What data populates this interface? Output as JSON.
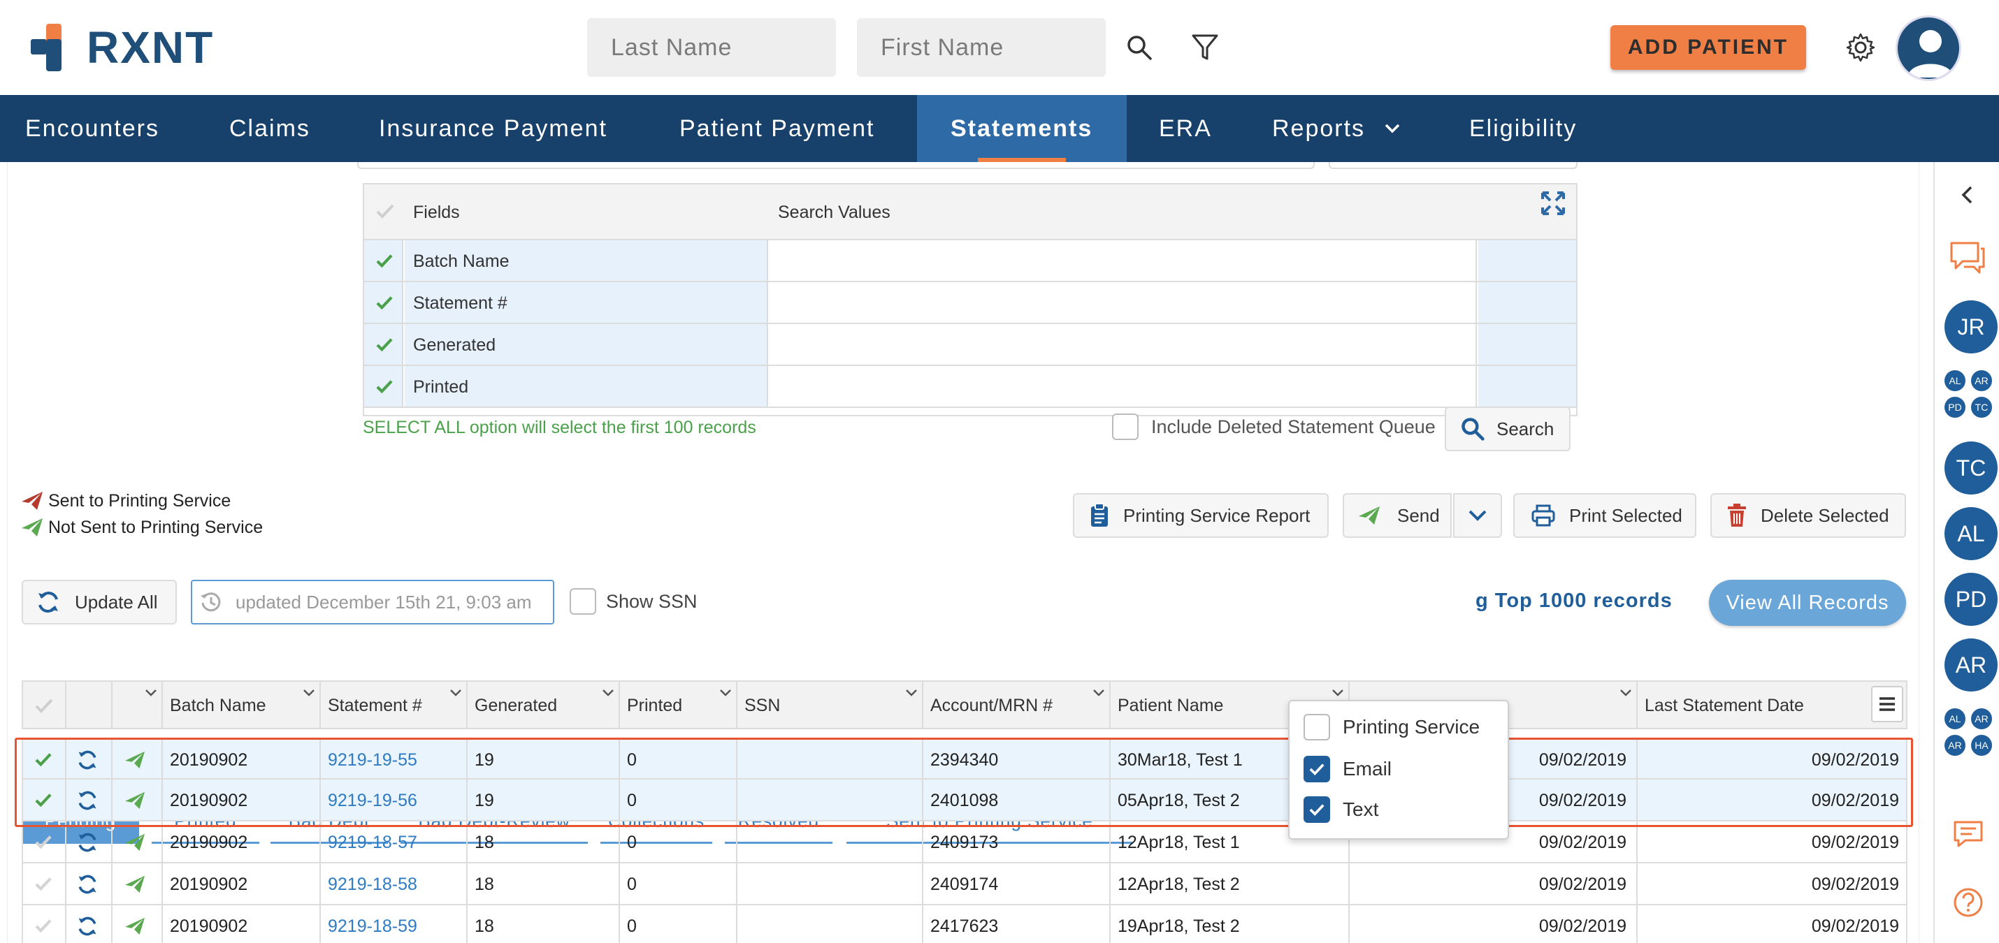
{
  "header": {
    "logo_text": "RXNT",
    "last_name_placeholder": "Last Name",
    "first_name_placeholder": "First Name",
    "add_patient_label": "ADD PATIENT"
  },
  "nav": {
    "items": [
      "Encounters",
      "Claims",
      "Insurance Payment",
      "Patient Payment",
      "Statements",
      "ERA",
      "Reports",
      "Eligibility"
    ],
    "active": "Statements"
  },
  "filters": {
    "col_fields": "Fields",
    "col_values": "Search Values",
    "rows": [
      "Batch Name",
      "Statement #",
      "Generated",
      "Printed"
    ]
  },
  "select_all_note": "SELECT ALL option will select the first 100 records",
  "include_deleted_label": "Include Deleted Statement Queue",
  "search_label": "Search",
  "legend": {
    "sent": "Sent to Printing Service",
    "not_sent": "Not Sent to Printing Service"
  },
  "actions": {
    "printing_report": "Printing Service Report",
    "send": "Send",
    "print_selected": "Print Selected",
    "delete_selected": "Delete Selected"
  },
  "send_menu": {
    "options": [
      {
        "label": "Printing Service",
        "checked": false
      },
      {
        "label": "Email",
        "checked": true
      },
      {
        "label": "Text",
        "checked": true
      }
    ]
  },
  "update_all_label": "Update All",
  "updated_placeholder": "updated December 15th 21, 9:03 am",
  "show_ssn_label": "Show SSN",
  "records_note": "g Top 1000 records",
  "view_all_label": "View All Records",
  "tabs": [
    "Pending",
    "Printed",
    "Bad Debt",
    "Bad Debt-Review",
    "Collections",
    "Resolved",
    "Sent to Printing Service"
  ],
  "table": {
    "headers": [
      "Batch Name",
      "Statement #",
      "Generated",
      "Printed",
      "SSN",
      "Account/MRN #",
      "Patient Name",
      "",
      "Last Statement Date"
    ],
    "rows": [
      {
        "checked": true,
        "selected": true,
        "batch": "20190902",
        "statement": "9219-19-55",
        "generated": "19",
        "printed": "0",
        "ssn": "",
        "account": "2394340",
        "patient": "30Mar18, Test 1",
        "date1": "09/02/2019",
        "last_date": "09/02/2019"
      },
      {
        "checked": true,
        "selected": true,
        "batch": "20190902",
        "statement": "9219-19-56",
        "generated": "19",
        "printed": "0",
        "ssn": "",
        "account": "2401098",
        "patient": "05Apr18, Test 2",
        "date1": "09/02/2019",
        "last_date": "09/02/2019"
      },
      {
        "checked": false,
        "selected": false,
        "batch": "20190902",
        "statement": "9219-18-57",
        "generated": "18",
        "printed": "0",
        "ssn": "",
        "account": "2409173",
        "patient": "12Apr18, Test 1",
        "date1": "09/02/2019",
        "last_date": "09/02/2019"
      },
      {
        "checked": false,
        "selected": false,
        "batch": "20190902",
        "statement": "9219-18-58",
        "generated": "18",
        "printed": "0",
        "ssn": "",
        "account": "2409174",
        "patient": "12Apr18, Test 2",
        "date1": "09/02/2019",
        "last_date": "09/02/2019"
      },
      {
        "checked": false,
        "selected": false,
        "batch": "20190902",
        "statement": "9219-18-59",
        "generated": "18",
        "printed": "0",
        "ssn": "",
        "account": "2417623",
        "patient": "19Apr18, Test 2",
        "date1": "09/02/2019",
        "last_date": "09/02/2019"
      }
    ]
  },
  "rail": {
    "circles": [
      "JR",
      "TC",
      "AL",
      "PD",
      "AR"
    ],
    "mini_group_1": [
      "AL",
      "AR",
      "PD",
      "TC"
    ],
    "mini_group_2": [
      "AL",
      "AR",
      "AR",
      "HA"
    ]
  },
  "colors": {
    "nav_bg": "#17406a",
    "nav_active": "#2e6aa6",
    "accent_orange": "#f07f45",
    "link_blue": "#2e7bc4",
    "check_green": "#4aa14a",
    "selection_outline": "#e8542f"
  }
}
